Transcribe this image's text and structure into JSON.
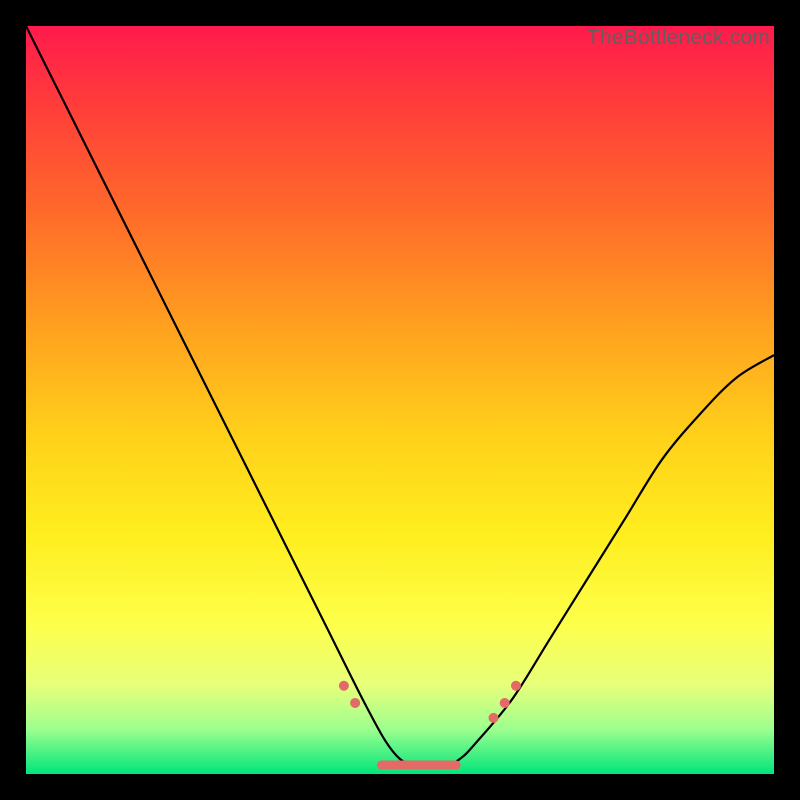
{
  "watermark": "TheBottleneck.com",
  "chart_data": {
    "type": "line",
    "title": "",
    "xlabel": "",
    "ylabel": "",
    "xlim": [
      0,
      1
    ],
    "ylim": [
      0,
      1
    ],
    "series": [
      {
        "name": "curve",
        "x": [
          0.0,
          0.05,
          0.1,
          0.15,
          0.2,
          0.25,
          0.3,
          0.35,
          0.4,
          0.45,
          0.48,
          0.5,
          0.52,
          0.54,
          0.56,
          0.58,
          0.6,
          0.65,
          0.7,
          0.75,
          0.8,
          0.85,
          0.9,
          0.95,
          1.0
        ],
        "y": [
          1.0,
          0.9,
          0.8,
          0.7,
          0.6,
          0.5,
          0.4,
          0.3,
          0.2,
          0.1,
          0.045,
          0.02,
          0.01,
          0.01,
          0.01,
          0.02,
          0.04,
          0.1,
          0.18,
          0.26,
          0.34,
          0.42,
          0.48,
          0.53,
          0.56
        ]
      }
    ],
    "markers": {
      "left_dots_x": [
        0.425,
        0.44
      ],
      "left_dots_y": [
        0.118,
        0.095
      ],
      "right_dots_x": [
        0.625,
        0.64,
        0.655
      ],
      "right_dots_y": [
        0.075,
        0.095,
        0.118
      ],
      "flat_segment": {
        "x0": 0.475,
        "x1": 0.575,
        "y": 0.012
      }
    },
    "background": "rainbow-vertical-gradient"
  }
}
